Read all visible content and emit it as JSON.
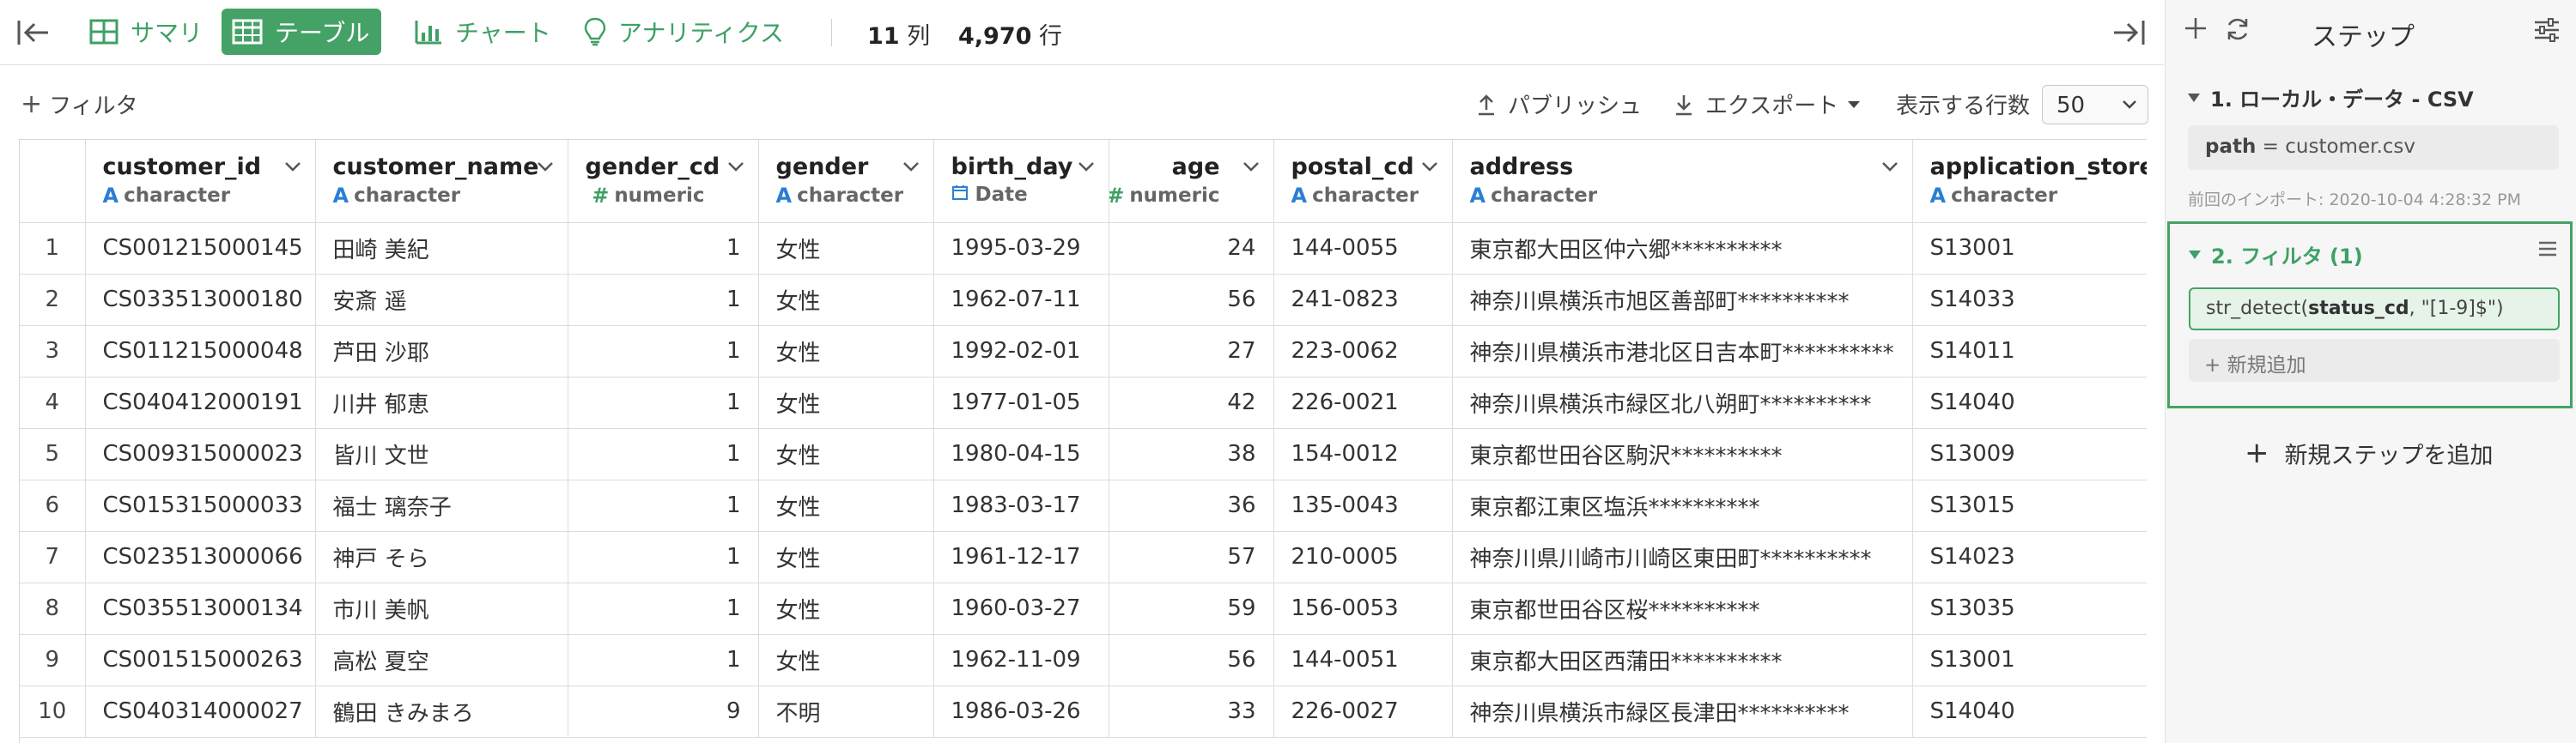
{
  "topbar": {
    "tabs": [
      {
        "label": "サマリ",
        "icon": "grid-icon",
        "active": false
      },
      {
        "label": "テーブル",
        "icon": "table-icon",
        "active": true
      },
      {
        "label": "チャート",
        "icon": "bar-chart-icon",
        "active": false
      },
      {
        "label": "アナリティクス",
        "icon": "lightbulb-icon",
        "active": false
      }
    ],
    "columns_count": "11",
    "columns_unit": "列",
    "rows_count": "4,970",
    "rows_unit": "行"
  },
  "toolbar": {
    "filter_label": "フィルタ",
    "publish_label": "パブリッシュ",
    "export_label": "エクスポート",
    "rows_label": "表示する行数",
    "rows_value": "50"
  },
  "table": {
    "columns": [
      {
        "name": "customer_id",
        "type": "character",
        "type_icon": "A"
      },
      {
        "name": "customer_name",
        "type": "character",
        "type_icon": "A"
      },
      {
        "name": "gender_cd",
        "type": "numeric",
        "type_icon": "#"
      },
      {
        "name": "gender",
        "type": "character",
        "type_icon": "A"
      },
      {
        "name": "birth_day",
        "type": "Date",
        "type_icon": "calendar"
      },
      {
        "name": "age",
        "type": "numeric",
        "type_icon": "#"
      },
      {
        "name": "postal_cd",
        "type": "character",
        "type_icon": "A"
      },
      {
        "name": "address",
        "type": "character",
        "type_icon": "A"
      },
      {
        "name": "application_store_cd",
        "type": "character",
        "type_icon": "A"
      }
    ],
    "rows": [
      {
        "n": "1",
        "customer_id": "CS001215000145",
        "customer_name": "田崎 美紀",
        "gender_cd": "1",
        "gender": "女性",
        "birth_day": "1995-03-29",
        "age": "24",
        "postal_cd": "144-0055",
        "address": "東京都大田区仲六郷**********",
        "application_store_cd": "S13001"
      },
      {
        "n": "2",
        "customer_id": "CS033513000180",
        "customer_name": "安斎 遥",
        "gender_cd": "1",
        "gender": "女性",
        "birth_day": "1962-07-11",
        "age": "56",
        "postal_cd": "241-0823",
        "address": "神奈川県横浜市旭区善部町**********",
        "application_store_cd": "S14033"
      },
      {
        "n": "3",
        "customer_id": "CS011215000048",
        "customer_name": "芦田 沙耶",
        "gender_cd": "1",
        "gender": "女性",
        "birth_day": "1992-02-01",
        "age": "27",
        "postal_cd": "223-0062",
        "address": "神奈川県横浜市港北区日吉本町**********",
        "application_store_cd": "S14011"
      },
      {
        "n": "4",
        "customer_id": "CS040412000191",
        "customer_name": "川井 郁恵",
        "gender_cd": "1",
        "gender": "女性",
        "birth_day": "1977-01-05",
        "age": "42",
        "postal_cd": "226-0021",
        "address": "神奈川県横浜市緑区北八朔町**********",
        "application_store_cd": "S14040"
      },
      {
        "n": "5",
        "customer_id": "CS009315000023",
        "customer_name": "皆川 文世",
        "gender_cd": "1",
        "gender": "女性",
        "birth_day": "1980-04-15",
        "age": "38",
        "postal_cd": "154-0012",
        "address": "東京都世田谷区駒沢**********",
        "application_store_cd": "S13009"
      },
      {
        "n": "6",
        "customer_id": "CS015315000033",
        "customer_name": "福士 璃奈子",
        "gender_cd": "1",
        "gender": "女性",
        "birth_day": "1983-03-17",
        "age": "36",
        "postal_cd": "135-0043",
        "address": "東京都江東区塩浜**********",
        "application_store_cd": "S13015"
      },
      {
        "n": "7",
        "customer_id": "CS023513000066",
        "customer_name": "神戸 そら",
        "gender_cd": "1",
        "gender": "女性",
        "birth_day": "1961-12-17",
        "age": "57",
        "postal_cd": "210-0005",
        "address": "神奈川県川崎市川崎区東田町**********",
        "application_store_cd": "S14023"
      },
      {
        "n": "8",
        "customer_id": "CS035513000134",
        "customer_name": "市川 美帆",
        "gender_cd": "1",
        "gender": "女性",
        "birth_day": "1960-03-27",
        "age": "59",
        "postal_cd": "156-0053",
        "address": "東京都世田谷区桜**********",
        "application_store_cd": "S13035"
      },
      {
        "n": "9",
        "customer_id": "CS001515000263",
        "customer_name": "高松 夏空",
        "gender_cd": "1",
        "gender": "女性",
        "birth_day": "1962-11-09",
        "age": "56",
        "postal_cd": "144-0051",
        "address": "東京都大田区西蒲田**********",
        "application_store_cd": "S13001"
      },
      {
        "n": "10",
        "customer_id": "CS040314000027",
        "customer_name": "鶴田 きみまろ",
        "gender_cd": "9",
        "gender": "不明",
        "birth_day": "1986-03-26",
        "age": "33",
        "postal_cd": "226-0027",
        "address": "神奈川県横浜市緑区長津田**********",
        "application_store_cd": "S14040"
      }
    ]
  },
  "steps_panel": {
    "title": "ステップ",
    "step1": {
      "title": "1. ローカル・データ - CSV",
      "param_key": "path",
      "param_eq": " = ",
      "param_value": "customer.csv",
      "import_note": "前回のインポート: 2020-10-04 4:28:32 PM"
    },
    "step2": {
      "title": "2. フィルタ (1)",
      "cond_fn": "str_detect(",
      "cond_arg": "status_cd",
      "cond_rest": ", \"[1-9]$\")",
      "new_add_label": "新規追加"
    },
    "add_step_label": "新規ステップを追加"
  },
  "colors": {
    "accent": "#45a266",
    "type_character": "#2a7fd4",
    "type_numeric": "#3ea065"
  }
}
